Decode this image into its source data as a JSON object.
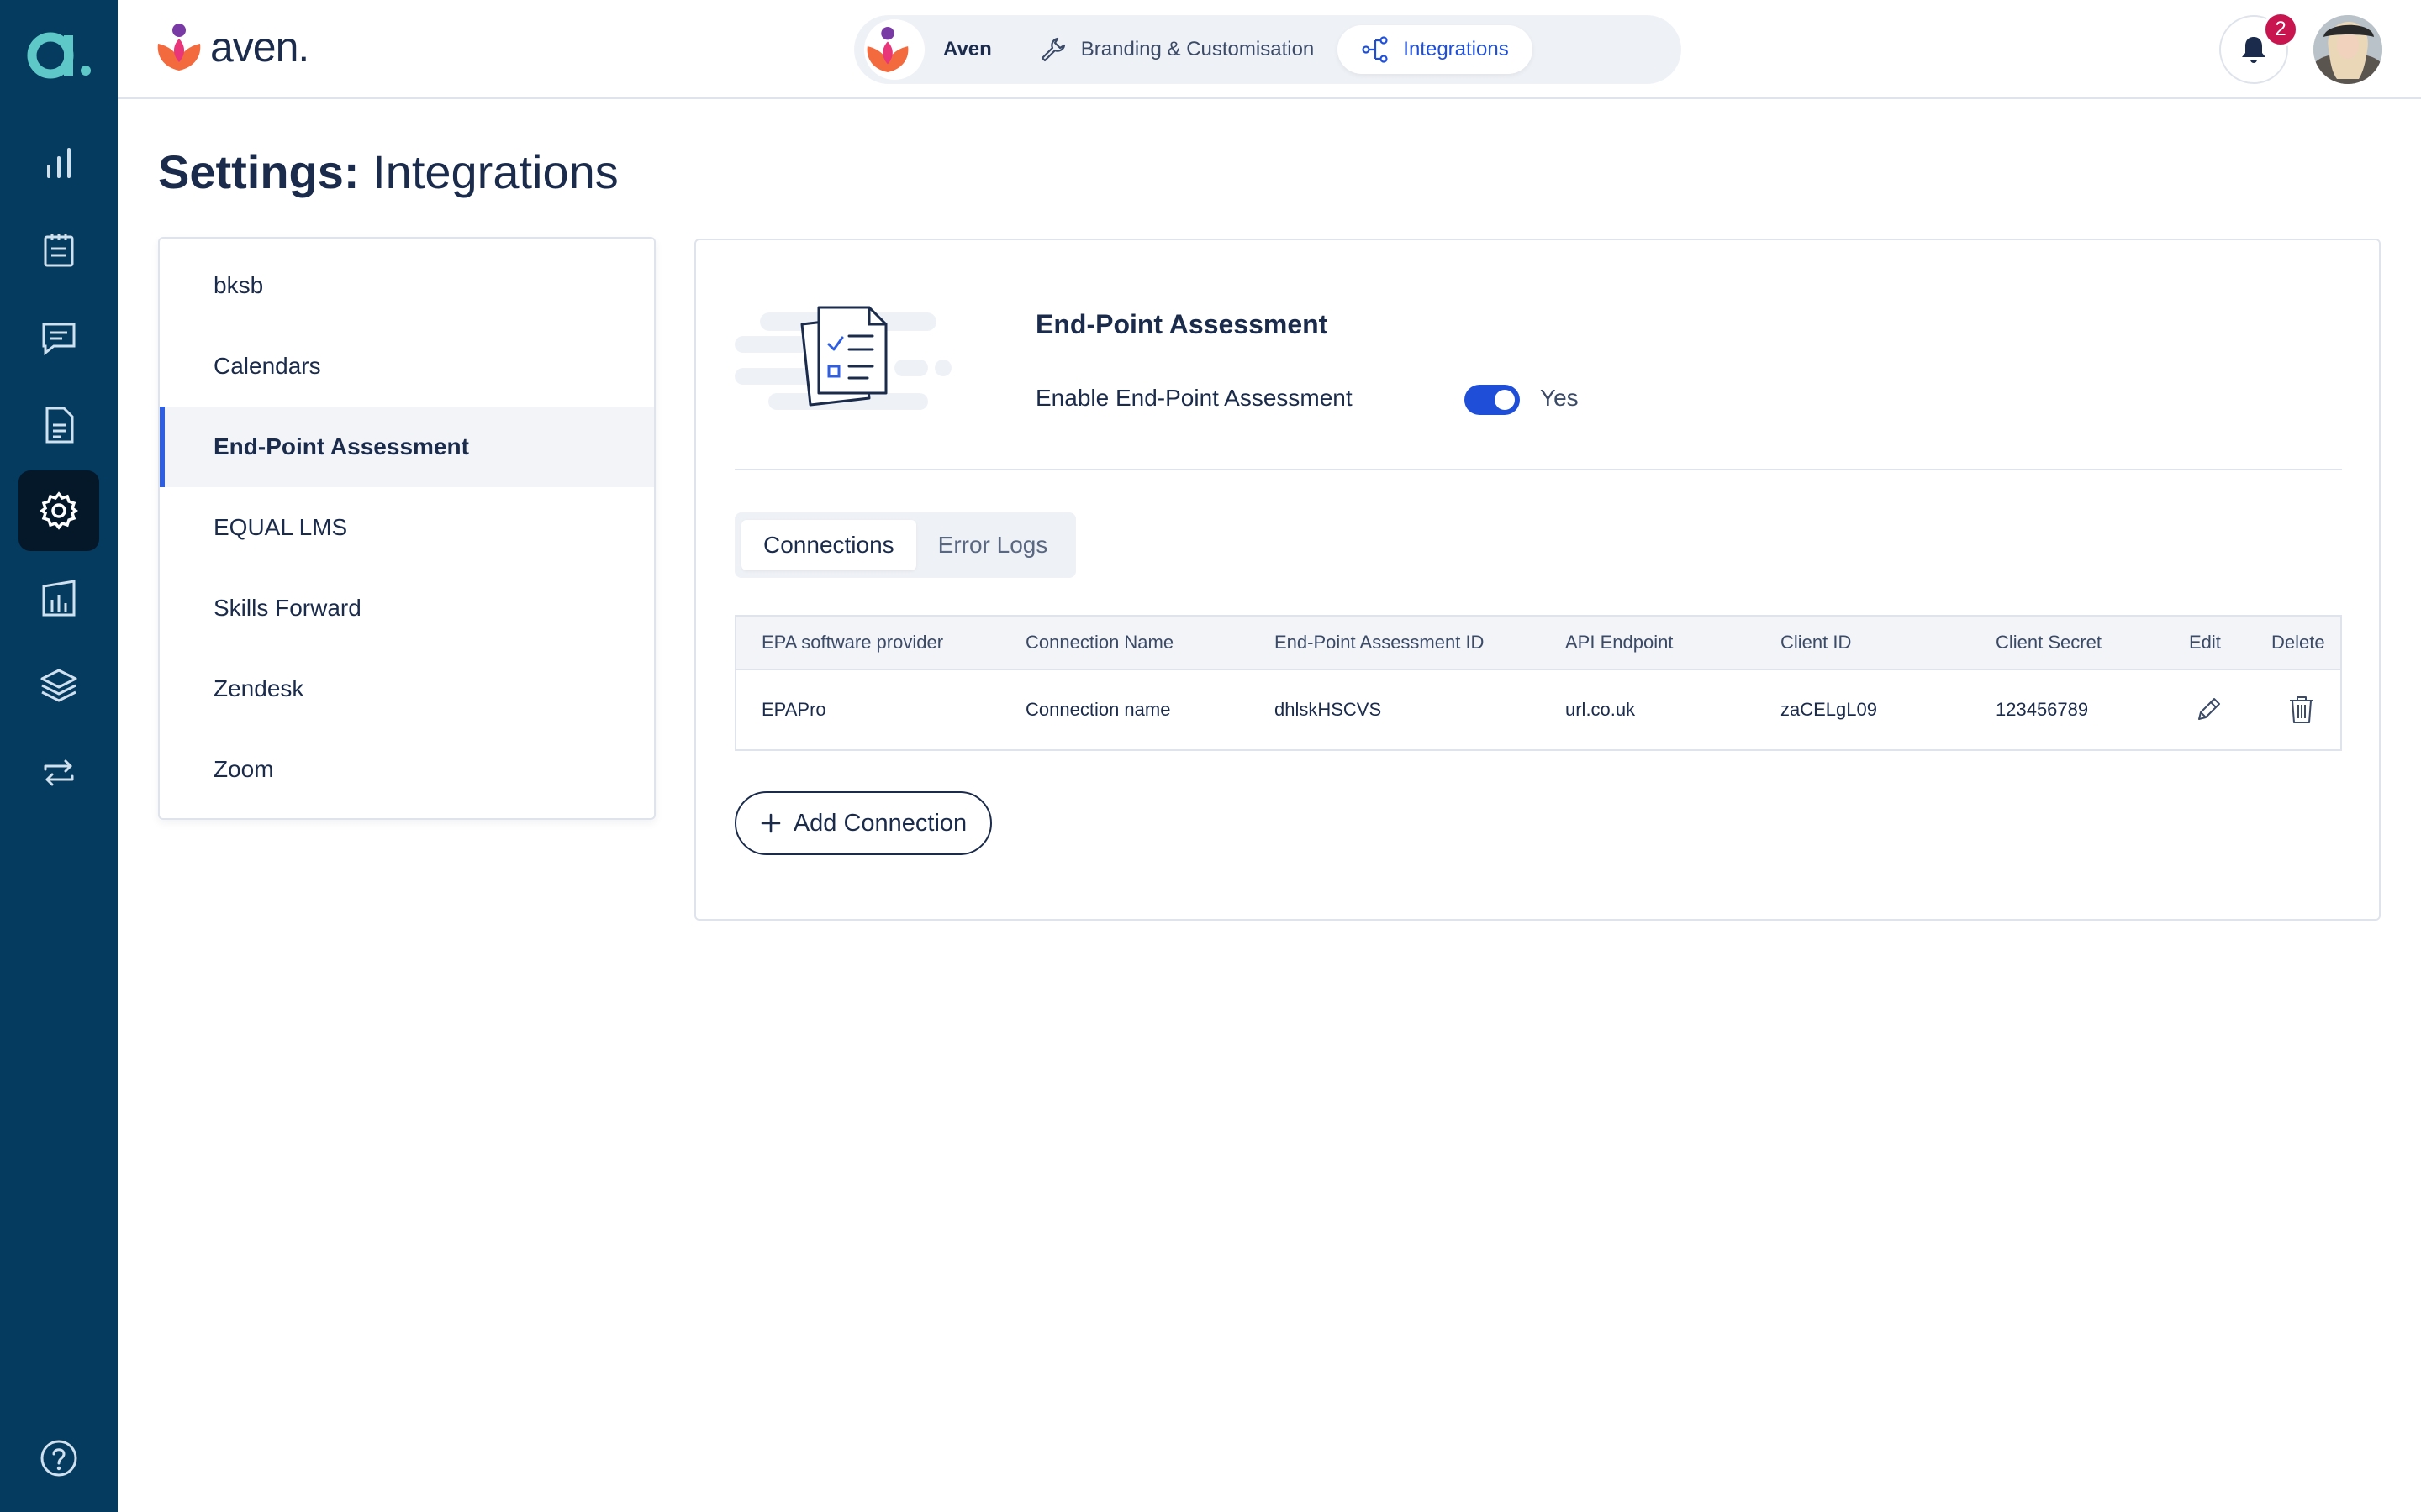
{
  "sidebar": {
    "logo": "a.",
    "icons": [
      "bar-chart-icon",
      "clipboard-icon",
      "chat-icon",
      "document-icon",
      "gear-icon",
      "report-chart-icon",
      "layers-icon",
      "sync-icon",
      "help-icon"
    ],
    "active": "gear-icon"
  },
  "topbar": {
    "brand": "aven.",
    "org_name": "Aven",
    "tabs": [
      {
        "label": "Branding & Customisation",
        "icon": "wrench-icon"
      },
      {
        "label": "Integrations",
        "icon": "integration-icon"
      }
    ],
    "notifications_count": "2"
  },
  "page": {
    "title_bold": "Settings:",
    "title_rest": " Integrations"
  },
  "integrations_menu": [
    {
      "label": "bksb"
    },
    {
      "label": "Calendars"
    },
    {
      "label": "End-Point Assessment"
    },
    {
      "label": "EQUAL LMS"
    },
    {
      "label": "Skills Forward"
    },
    {
      "label": "Zendesk"
    },
    {
      "label": "Zoom"
    }
  ],
  "epa": {
    "title": "End-Point Assessment",
    "enable_label": "Enable End-Point Assessment",
    "toggle_state": "Yes",
    "tabs": [
      "Connections",
      "Error Logs"
    ],
    "table": {
      "headers": [
        "EPA software provider",
        "Connection Name",
        "End-Point Assessment ID",
        "API Endpoint",
        "Client ID",
        "Client Secret",
        "Edit",
        "Delete"
      ],
      "rows": [
        [
          "EPAPro",
          "Connection name",
          "dhlskHSCVS",
          "url.co.uk",
          "zaCELgL09",
          "123456789"
        ]
      ]
    },
    "add_button": "Add Connection"
  },
  "colors": {
    "sidebar": "#063b60",
    "accent": "#1f4fd8",
    "badge": "#c8154f",
    "text": "#1b2b4b"
  }
}
